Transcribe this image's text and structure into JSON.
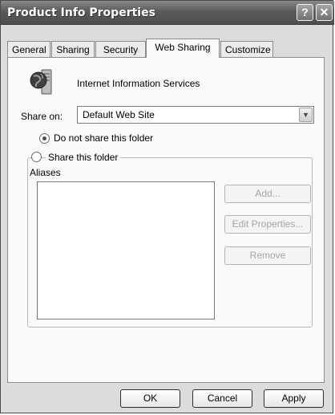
{
  "window": {
    "title": "Product Info Properties",
    "help_label": "?",
    "close_label": "✕"
  },
  "tabs": [
    {
      "label": "General",
      "active": false
    },
    {
      "label": "Sharing",
      "active": false
    },
    {
      "label": "Security",
      "active": false
    },
    {
      "label": "Web Sharing",
      "active": true
    },
    {
      "label": "Customize",
      "active": false
    }
  ],
  "web_sharing": {
    "service_label": "Internet Information Services",
    "service_icon": "iis-globe-server-icon",
    "share_on_label": "Share on:",
    "share_on_value": "Default Web Site",
    "no_share_label": "Do not share this folder",
    "no_share_selected": true,
    "share_label": "Share this folder",
    "share_selected": false,
    "aliases_label": "Aliases",
    "aliases": [],
    "add_label": "Add...",
    "edit_label": "Edit Properties...",
    "remove_label": "Remove"
  },
  "footer": {
    "ok_label": "OK",
    "cancel_label": "Cancel",
    "apply_label": "Apply"
  }
}
